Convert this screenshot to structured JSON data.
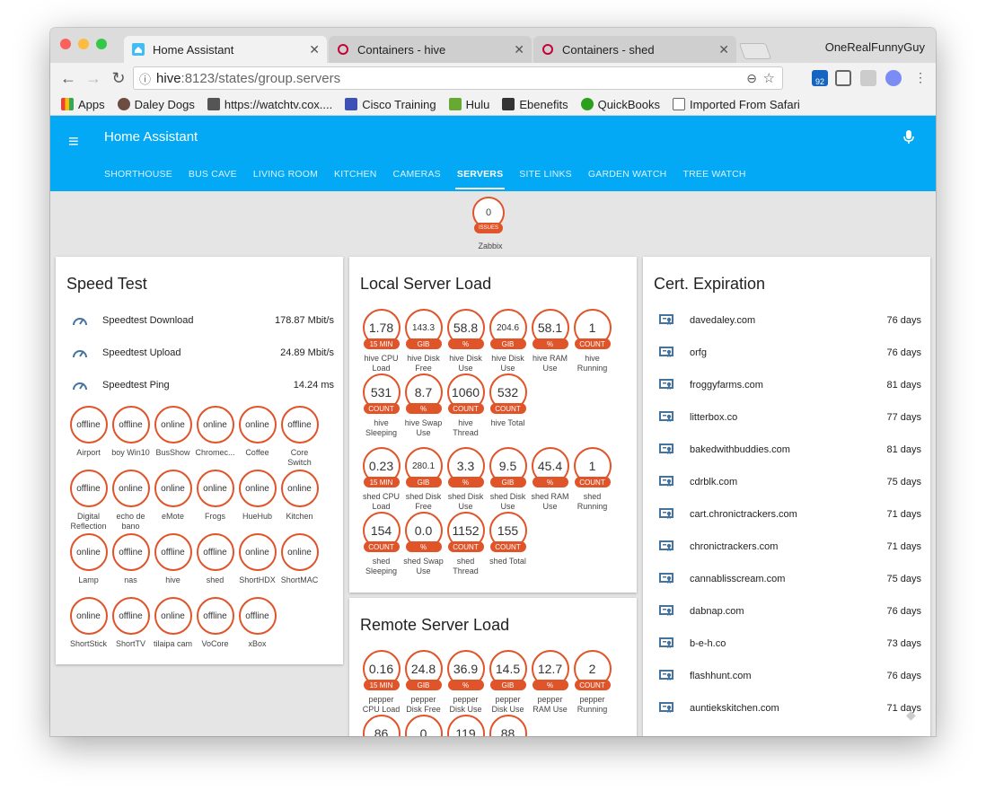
{
  "browser": {
    "tabs": [
      {
        "label": "Home Assistant",
        "active": true
      },
      {
        "label": "Containers - hive",
        "active": false
      },
      {
        "label": "Containers - shed",
        "active": false
      }
    ],
    "profile": "OneRealFunnyGuy",
    "url_host": "hive",
    "url_path": ":8123/states/group.servers",
    "extension_badge": "92",
    "bookmarks": [
      "Apps",
      "Daley Dogs",
      "https://watchtv.cox....",
      "Cisco Training",
      "Hulu",
      "Ebenefits",
      "QuickBooks",
      "Imported From Safari"
    ]
  },
  "header": {
    "title": "Home Assistant",
    "tabs": [
      "SHORTHOUSE",
      "BUS CAVE",
      "LIVING ROOM",
      "KITCHEN",
      "CAMERAS",
      "SERVERS",
      "SITE LINKS",
      "GARDEN WATCH",
      "TREE WATCH"
    ],
    "active_tab": "SERVERS"
  },
  "zabbix": {
    "value": "0",
    "unit": "ISSUES",
    "name": "Zabbix"
  },
  "speed_test": {
    "title": "Speed Test",
    "rows": [
      {
        "name": "Speedtest Download",
        "value": "178.87 Mbit/s"
      },
      {
        "name": "Speedtest Upload",
        "value": "24.89 Mbit/s"
      },
      {
        "name": "Speedtest Ping",
        "value": "14.24 ms"
      }
    ],
    "devices": [
      {
        "state": "offline",
        "name": "Airport"
      },
      {
        "state": "offline",
        "name": "boy Win10"
      },
      {
        "state": "online",
        "name": "BusShow"
      },
      {
        "state": "online",
        "name": "Chromec..."
      },
      {
        "state": "online",
        "name": "Coffee"
      },
      {
        "state": "offline",
        "name": "Core Switch"
      },
      {
        "state": "offline",
        "name": "Digital Reflection"
      },
      {
        "state": "online",
        "name": "echo de bano"
      },
      {
        "state": "online",
        "name": "eMote"
      },
      {
        "state": "online",
        "name": "Frogs"
      },
      {
        "state": "online",
        "name": "HueHub"
      },
      {
        "state": "online",
        "name": "Kitchen"
      },
      {
        "state": "online",
        "name": "Lamp"
      },
      {
        "state": "offline",
        "name": "nas"
      },
      {
        "state": "offline",
        "name": "hive"
      },
      {
        "state": "offline",
        "name": "shed"
      },
      {
        "state": "online",
        "name": "ShortHDX"
      },
      {
        "state": "online",
        "name": "ShortMAC"
      },
      {
        "state": "online",
        "name": "ShortStick"
      },
      {
        "state": "offline",
        "name": "ShortTV"
      },
      {
        "state": "online",
        "name": "tilaipa cam"
      },
      {
        "state": "offline",
        "name": "VoCore"
      },
      {
        "state": "offline",
        "name": "xBox"
      }
    ]
  },
  "local_load": {
    "title": "Local Server Load",
    "hive": [
      {
        "value": "1.78",
        "unit": "15 MIN",
        "name": "hive CPU Load"
      },
      {
        "value": "143.3",
        "unit": "GIB",
        "name": "hive Disk Free"
      },
      {
        "value": "58.8",
        "unit": "%",
        "name": "hive Disk Use"
      },
      {
        "value": "204.6",
        "unit": "GIB",
        "name": "hive Disk Use"
      },
      {
        "value": "58.1",
        "unit": "%",
        "name": "hive RAM Use"
      },
      {
        "value": "1",
        "unit": "COUNT",
        "name": "hive Running"
      },
      {
        "value": "531",
        "unit": "COUNT",
        "name": "hive Sleeping"
      },
      {
        "value": "8.7",
        "unit": "%",
        "name": "hive Swap Use"
      },
      {
        "value": "1060",
        "unit": "COUNT",
        "name": "hive Thread"
      },
      {
        "value": "532",
        "unit": "COUNT",
        "name": "hive Total"
      }
    ],
    "shed": [
      {
        "value": "0.23",
        "unit": "15 MIN",
        "name": "shed CPU Load"
      },
      {
        "value": "280.1",
        "unit": "GIB",
        "name": "shed Disk Free"
      },
      {
        "value": "3.3",
        "unit": "%",
        "name": "shed Disk Use"
      },
      {
        "value": "9.5",
        "unit": "GIB",
        "name": "shed Disk Use"
      },
      {
        "value": "45.4",
        "unit": "%",
        "name": "shed RAM Use"
      },
      {
        "value": "1",
        "unit": "COUNT",
        "name": "shed Running"
      },
      {
        "value": "154",
        "unit": "COUNT",
        "name": "shed Sleeping"
      },
      {
        "value": "0.0",
        "unit": "%",
        "name": "shed Swap Use"
      },
      {
        "value": "1152",
        "unit": "COUNT",
        "name": "shed Thread"
      },
      {
        "value": "155",
        "unit": "COUNT",
        "name": "shed Total"
      }
    ]
  },
  "remote_load": {
    "title": "Remote Server Load",
    "pepper": [
      {
        "value": "0.16",
        "unit": "15 MIN",
        "name": "pepper CPU Load"
      },
      {
        "value": "24.8",
        "unit": "GIB",
        "name": "pepper Disk Free"
      },
      {
        "value": "36.9",
        "unit": "%",
        "name": "pepper Disk Use"
      },
      {
        "value": "14.5",
        "unit": "GIB",
        "name": "pepper Disk Use"
      },
      {
        "value": "12.7",
        "unit": "%",
        "name": "pepper RAM Use"
      },
      {
        "value": "2",
        "unit": "COUNT",
        "name": "pepper Running"
      },
      {
        "value": "86",
        "unit": "",
        "name": ""
      },
      {
        "value": "0",
        "unit": "",
        "name": ""
      },
      {
        "value": "119",
        "unit": "",
        "name": ""
      },
      {
        "value": "88",
        "unit": "",
        "name": ""
      }
    ]
  },
  "certs": {
    "title": "Cert. Expiration",
    "rows": [
      {
        "name": "davedaley.com",
        "value": "76 days"
      },
      {
        "name": "orfg",
        "value": "76 days"
      },
      {
        "name": "froggyfarms.com",
        "value": "81 days"
      },
      {
        "name": "litterbox.co",
        "value": "77 days"
      },
      {
        "name": "bakedwithbuddies.com",
        "value": "81 days"
      },
      {
        "name": "cdrblk.com",
        "value": "75 days"
      },
      {
        "name": "cart.chronictrackers.com",
        "value": "71 days"
      },
      {
        "name": "chronictrackers.com",
        "value": "71 days"
      },
      {
        "name": "cannablisscream.com",
        "value": "75 days"
      },
      {
        "name": "dabnap.com",
        "value": "76 days"
      },
      {
        "name": "b-e-h.co",
        "value": "73 days"
      },
      {
        "name": "flashhunt.com",
        "value": "76 days"
      },
      {
        "name": "auntiekskitchen.com",
        "value": "71 days"
      }
    ]
  },
  "colors": {
    "accent": "#03a9f4",
    "badge": "#e0542a",
    "background": "#e5e5e5"
  }
}
